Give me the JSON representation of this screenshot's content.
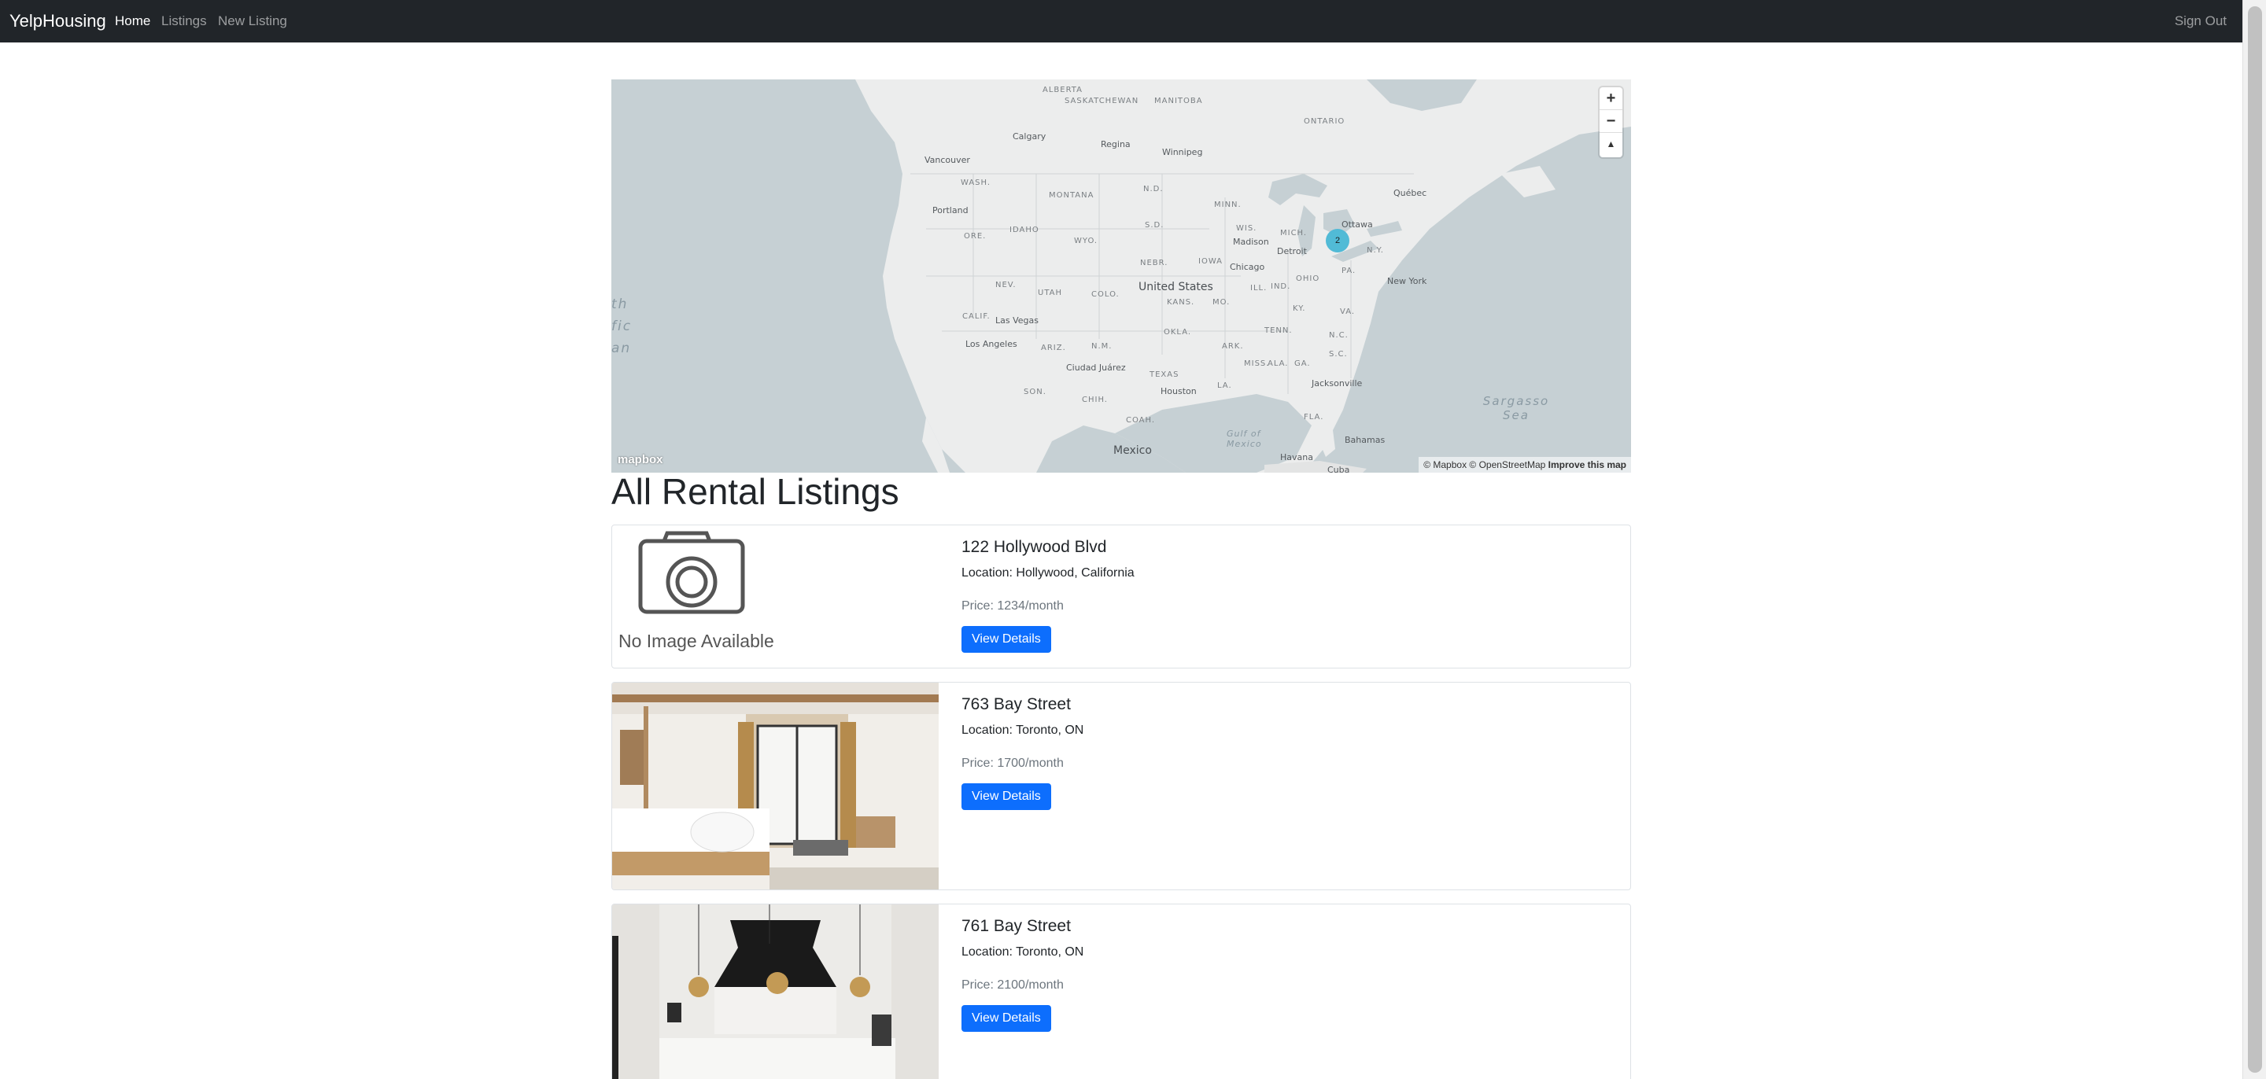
{
  "navbar": {
    "brand": "YelpHousing",
    "links": [
      {
        "label": "Home",
        "active": true
      },
      {
        "label": "Listings",
        "active": false
      },
      {
        "label": "New Listing",
        "active": false
      }
    ],
    "sign_out": "Sign Out"
  },
  "map": {
    "cluster_count": "2",
    "controls": {
      "zoom_in": "+",
      "zoom_out": "−",
      "reset": "▲"
    },
    "logo": "mapbox",
    "attribution": "© Mapbox © OpenStreetMap",
    "attribution_link": "Improve this map",
    "labels": {
      "alberta": "ALBERTA",
      "saskatchewan": "SASKATCHEWAN",
      "manitoba": "MANITOBA",
      "ontario": "ONTARIO",
      "calgary": "Calgary",
      "regina": "Regina",
      "winnipeg": "Winnipeg",
      "vancouver": "Vancouver",
      "wash": "WASH.",
      "montana": "MONTANA",
      "nd": "N.D.",
      "minn": "MINN.",
      "quebec": "Québec",
      "ottawa": "Ottawa",
      "portland": "Portland",
      "ore": "ORE.",
      "idaho": "IDAHO",
      "wyo": "WYO.",
      "sd": "S.D.",
      "wis": "WIS.",
      "mich": "MICH.",
      "madison": "Madison",
      "detroit": "Detroit",
      "ny": "N.Y.",
      "nebr": "NEBR.",
      "iowa": "IOWA",
      "chicago": "Chicago",
      "ohio": "OHIO",
      "pa": "PA.",
      "new_york": "New York",
      "nev": "NEV.",
      "utah": "UTAH",
      "colo": "COLO.",
      "united_states": "United States",
      "kans": "KANS.",
      "mo": "MO.",
      "ill": "ILL.",
      "ind": "IND.",
      "va": "VA.",
      "ky": "KY.",
      "calif": "CALIF.",
      "las_vegas": "Las Vegas",
      "okla": "OKLA.",
      "tenn": "TENN.",
      "nc": "N.C.",
      "los_angeles": "Los Angeles",
      "ariz": "ARIZ.",
      "nm": "N.M.",
      "ark": "ARK.",
      "sc": "S.C.",
      "ciudad_juarez": "Ciudad Juárez",
      "texas": "TEXAS",
      "miss": "MISS.",
      "ala": "ALA.",
      "ga": "GA.",
      "la": "LA.",
      "jacksonville": "Jacksonville",
      "son": "SON.",
      "chih": "CHIH.",
      "houston": "Houston",
      "coah": "COAH.",
      "fla": "FLA.",
      "gulf_of_mexico": "Gulf of Mexico",
      "bahamas": "Bahamas",
      "mexico": "Mexico",
      "havana": "Havana",
      "cuba": "Cuba",
      "pacific_ocean": "th fic an",
      "sargasso_sea": "Sargasso Sea"
    }
  },
  "page_title": "All Rental Listings",
  "listings": [
    {
      "title": "122 Hollywood Blvd",
      "location": "Location: Hollywood, California",
      "price": "Price: 1234/month",
      "button": "View Details",
      "image_placeholder": "No Image Available"
    },
    {
      "title": "763 Bay Street",
      "location": "Location: Toronto, ON",
      "price": "Price: 1700/month",
      "button": "View Details"
    },
    {
      "title": "761 Bay Street",
      "location": "Location: Toronto, ON",
      "price": "Price: 2100/month",
      "button": "View Details"
    }
  ]
}
